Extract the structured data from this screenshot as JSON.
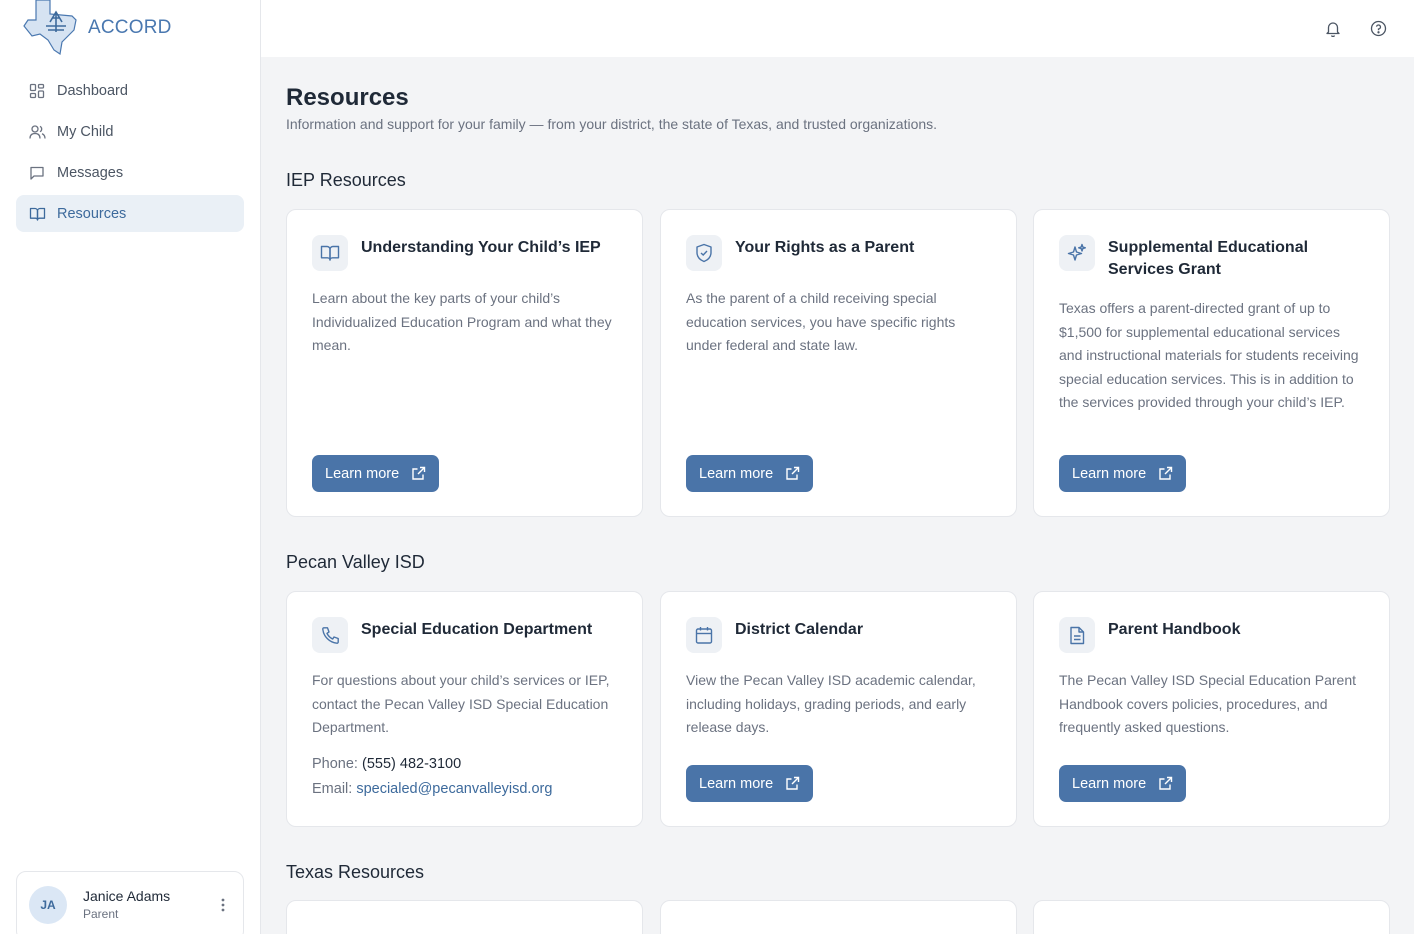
{
  "app": {
    "name": "ACCORD"
  },
  "sidebar": {
    "items": [
      {
        "label": "Dashboard",
        "icon": "dashboard-icon"
      },
      {
        "label": "My Child",
        "icon": "users-icon"
      },
      {
        "label": "Messages",
        "icon": "message-icon"
      },
      {
        "label": "Resources",
        "icon": "book-open-icon",
        "active": true
      }
    ],
    "user": {
      "initials": "JA",
      "name": "Janice Adams",
      "role": "Parent"
    }
  },
  "topbar": {
    "icons": [
      "bell-icon",
      "help-circle-icon"
    ]
  },
  "page": {
    "title": "Resources",
    "subtitle": "Information and support for your family — from your district, the state of Texas, and trusted organizations."
  },
  "sections": {
    "iep": {
      "title": "IEP Resources",
      "cards": [
        {
          "title": "Understanding Your Child’s IEP",
          "desc": "Learn about the key parts of your child’s Individualized Education Program and what they mean.",
          "button": "Learn more",
          "icon": "book-open-icon"
        },
        {
          "title": "Your Rights as a Parent",
          "desc": "As the parent of a child receiving special education services, you have specific rights under federal and state law.",
          "button": "Learn more",
          "icon": "shield-check-icon"
        },
        {
          "title": "Supplemental Educational Services Grant",
          "desc": "Texas offers a parent-directed grant of up to $1,500 for supplemental educational services and instructional materials for students receiving special education services. This is in addition to the services provided through your child’s IEP.",
          "button": "Learn more",
          "icon": "sparkles-icon"
        }
      ]
    },
    "district": {
      "title": "Pecan Valley ISD",
      "cards": [
        {
          "title": "Special Education Department",
          "desc": "For questions about your child’s services or IEP, contact the Pecan Valley ISD Special Education Department.",
          "phone_label": "Phone:",
          "phone": "(555) 482-3100",
          "email_label": "Email:",
          "email": "specialed@pecanvalleyisd.org",
          "icon": "phone-icon"
        },
        {
          "title": "District Calendar",
          "desc": "View the Pecan Valley ISD academic calendar, including holidays, grading periods, and early release days.",
          "button": "Learn more",
          "icon": "calendar-icon"
        },
        {
          "title": "Parent Handbook",
          "desc": "The Pecan Valley ISD Special Education Parent Handbook covers policies, procedures, and frequently asked questions.",
          "button": "Learn more",
          "icon": "file-text-icon"
        }
      ]
    },
    "texas": {
      "title": "Texas Resources"
    }
  },
  "colors": {
    "accent": "#4a74a8",
    "brand": "#4a78b0",
    "active_bg": "#eaf0f6"
  }
}
